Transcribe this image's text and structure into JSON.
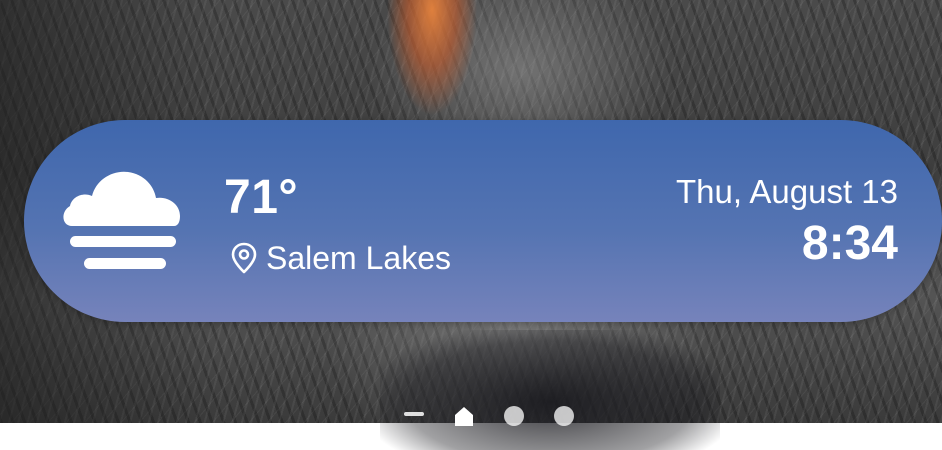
{
  "weather_widget": {
    "condition_icon": "fog-icon",
    "temperature": "71°",
    "location_icon": "location-pin-icon",
    "location": "Salem Lakes",
    "date": "Thu, August 13",
    "time": "8:34"
  },
  "page_indicator": {
    "items": [
      "minus-page",
      "home-icon",
      "page-dot",
      "page-dot"
    ],
    "current": "home"
  },
  "colors": {
    "widget_top": "#3f67ad",
    "widget_bottom": "#7683bb",
    "text": "#ffffff"
  }
}
